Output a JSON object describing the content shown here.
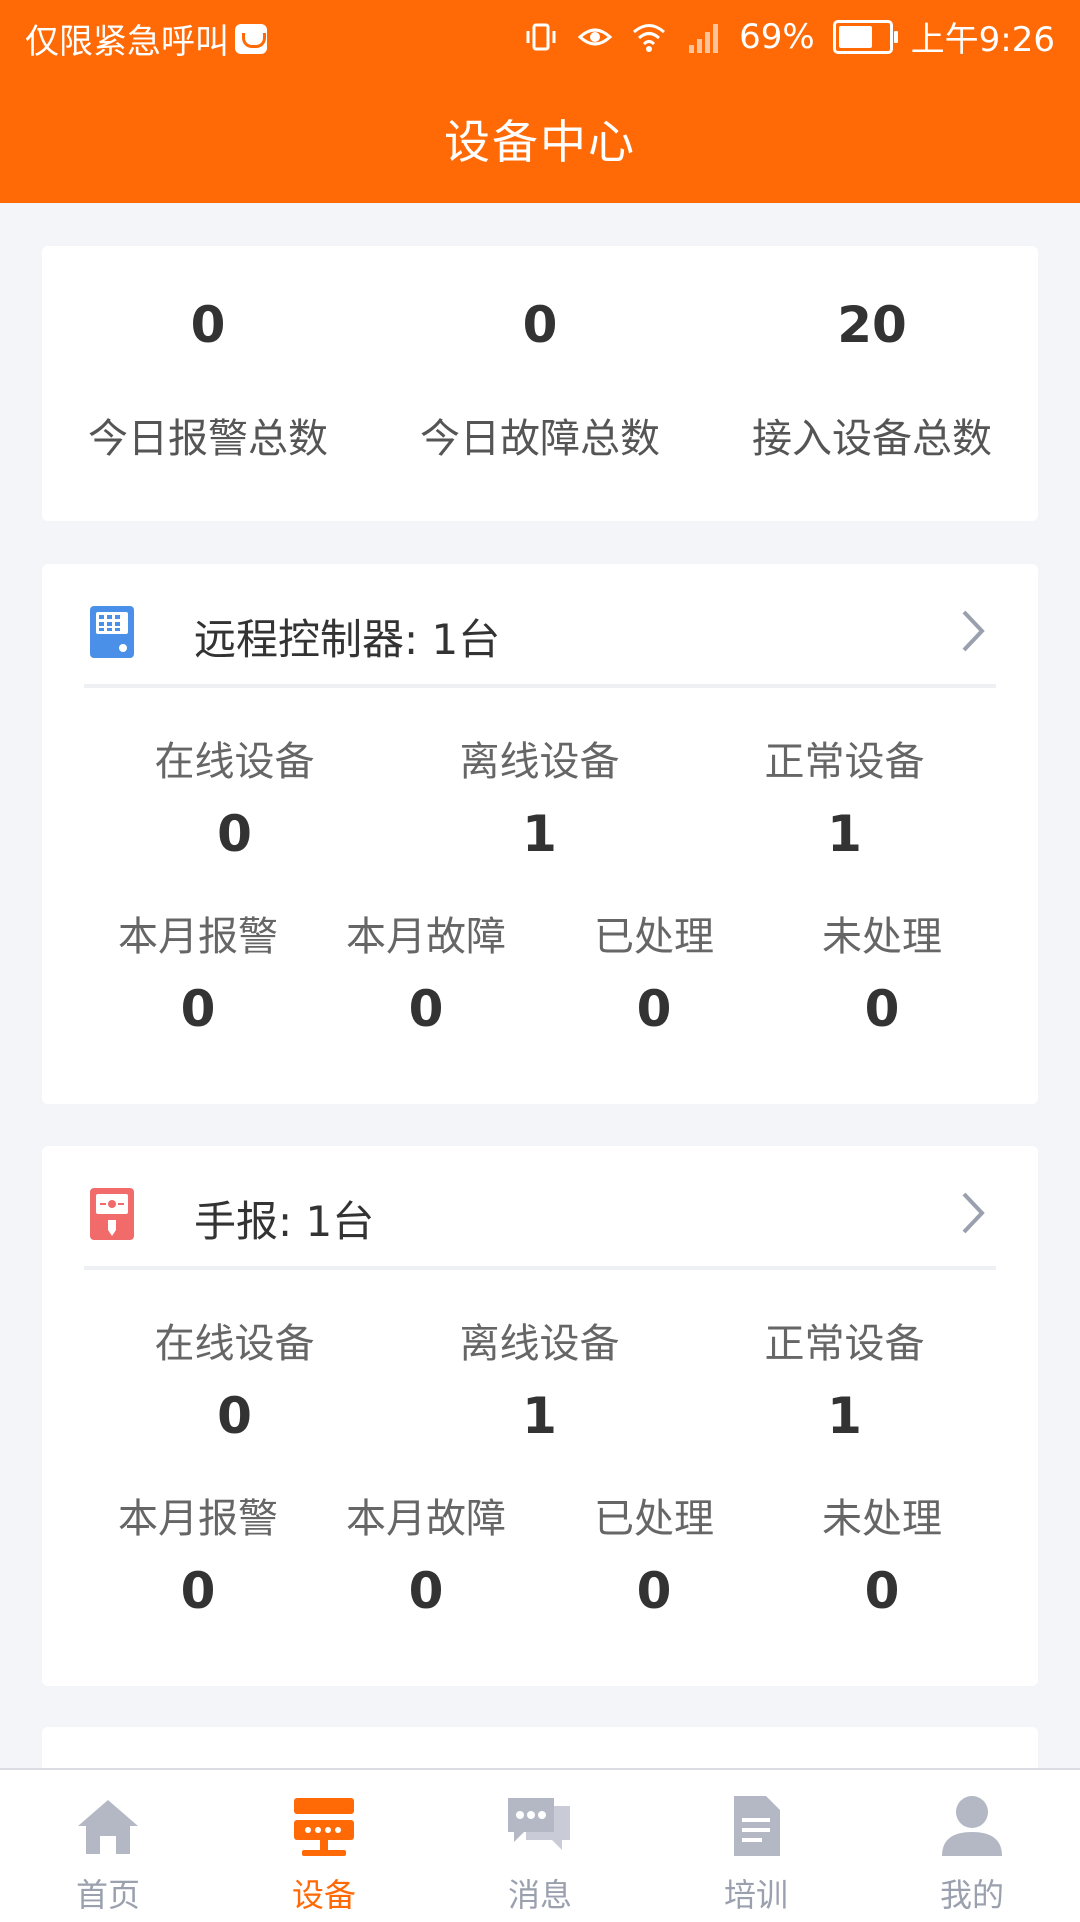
{
  "status_bar": {
    "carrier_text": "仅限紧急呼叫",
    "battery_percent": "69%",
    "time": "上午9:26",
    "icons": [
      "vibrate-icon",
      "eye-icon",
      "wifi-icon",
      "signal-icon",
      "battery-icon"
    ]
  },
  "header": {
    "title": "设备中心"
  },
  "summary": {
    "items": [
      {
        "value": "0",
        "label": "今日报警总数"
      },
      {
        "value": "0",
        "label": "今日故障总数"
      },
      {
        "value": "20",
        "label": "接入设备总数"
      }
    ]
  },
  "devices": [
    {
      "title": "远程控制器: 1台",
      "icon": "remote-controller-icon",
      "icon_color": "#4a90e8",
      "stats_top": [
        {
          "label": "在线设备",
          "value": "0"
        },
        {
          "label": "离线设备",
          "value": "1"
        },
        {
          "label": "正常设备",
          "value": "1"
        }
      ],
      "stats_bottom": [
        {
          "label": "本月报警",
          "value": "0"
        },
        {
          "label": "本月故障",
          "value": "0"
        },
        {
          "label": "已处理",
          "value": "0"
        },
        {
          "label": "未处理",
          "value": "0"
        }
      ]
    },
    {
      "title": "手报: 1台",
      "icon": "manual-alarm-icon",
      "icon_color": "#f26b6b",
      "stats_top": [
        {
          "label": "在线设备",
          "value": "0"
        },
        {
          "label": "离线设备",
          "value": "1"
        },
        {
          "label": "正常设备",
          "value": "1"
        }
      ],
      "stats_bottom": [
        {
          "label": "本月报警",
          "value": "0"
        },
        {
          "label": "本月故障",
          "value": "0"
        },
        {
          "label": "已处理",
          "value": "0"
        },
        {
          "label": "未处理",
          "value": "0"
        }
      ]
    }
  ],
  "bottom_nav": {
    "active_index": 1,
    "active_color": "#ff6a07",
    "inactive_color": "#b4b8c5",
    "items": [
      {
        "label": "首页",
        "icon": "home-icon"
      },
      {
        "label": "设备",
        "icon": "device-icon"
      },
      {
        "label": "消息",
        "icon": "message-icon"
      },
      {
        "label": "培训",
        "icon": "training-icon"
      },
      {
        "label": "我的",
        "icon": "profile-icon"
      }
    ]
  },
  "colors": {
    "brand": "#ff6a07",
    "background": "#f4f5f8"
  }
}
